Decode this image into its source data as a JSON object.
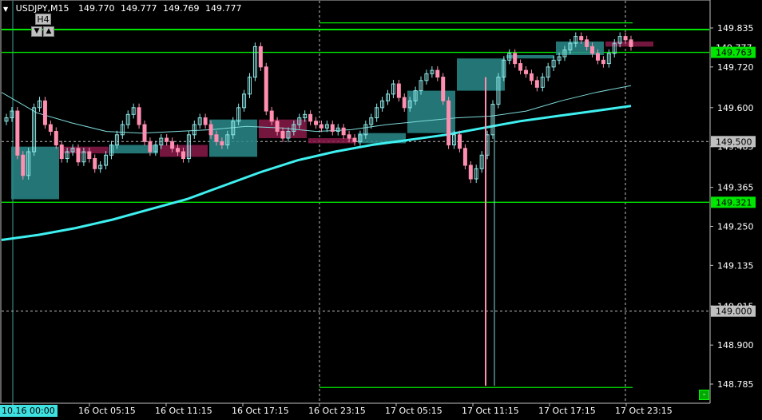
{
  "header": {
    "symbol": "USDJPY,M15",
    "open": "149.770",
    "high": "149.777",
    "low": "149.769",
    "close": "149.777"
  },
  "timeframe_box": {
    "label": "H4",
    "down": "▼",
    "up": "▲"
  },
  "minus_button": "-",
  "colors": {
    "background": "#000000",
    "bull_candle": "#8fe8e8",
    "bear_candle": "#ff8fb0",
    "bull_box": "#2a8a8a",
    "bear_box": "#8a1a4a",
    "ma_thick": "#3ff0f0",
    "ma_thin": "#7fdada",
    "hline": "#00e600",
    "price_tag_bg": "#00e600",
    "axis_text": "#ffffff"
  },
  "chart_data": {
    "type": "candlestick",
    "title": "USDJPY,M15",
    "price_axis": {
      "ticks": [
        "149.835",
        "149.720",
        "149.600",
        "149.485",
        "149.365",
        "149.250",
        "149.135",
        "149.015",
        "148.900",
        "148.785"
      ],
      "tick_values": [
        149.835,
        149.72,
        149.6,
        149.485,
        149.365,
        149.25,
        149.135,
        149.015,
        148.9,
        148.785
      ],
      "ylim": [
        148.75,
        149.87
      ],
      "current_top_label": "149.777"
    },
    "time_axis": {
      "labels": [
        "10.16 00:00",
        "16 Oct 05:15",
        "16 Oct 11:15",
        "16 Oct 17:15",
        "16 Oct 23:15",
        "17 Oct 05:15",
        "17 Oct 11:15",
        "17 Oct 17:15",
        "17 Oct 23:15"
      ]
    },
    "horizontal_levels": [
      {
        "name": "level-149.850",
        "value": 149.85,
        "color": "#00e600",
        "style": "solid"
      },
      {
        "name": "level-149.763",
        "value": 149.763,
        "color": "#00e600",
        "style": "solid",
        "label": "149.763"
      },
      {
        "name": "level-149.321",
        "value": 149.321,
        "color": "#00e600",
        "style": "solid",
        "label": "149.321"
      },
      {
        "name": "level-148.775",
        "value": 148.775,
        "color": "#00e600",
        "style": "solid"
      },
      {
        "name": "level-149.500",
        "value": 149.5,
        "color": "#c0c0c0",
        "style": "dotted",
        "label": "149.500"
      },
      {
        "name": "level-149.000",
        "value": 149.0,
        "color": "#c0c0c0",
        "style": "dotted",
        "label": "149.000"
      }
    ],
    "h4_boxes": [
      {
        "o": 149.33,
        "c": 149.485,
        "dir": "up"
      },
      {
        "o": 149.485,
        "c": 149.465,
        "dir": "down"
      },
      {
        "o": 149.465,
        "c": 149.49,
        "dir": "up"
      },
      {
        "o": 149.49,
        "c": 149.455,
        "dir": "down"
      },
      {
        "o": 149.455,
        "c": 149.565,
        "dir": "up"
      },
      {
        "o": 149.565,
        "c": 149.51,
        "dir": "down"
      },
      {
        "o": 149.51,
        "c": 149.495,
        "dir": "down"
      },
      {
        "o": 149.495,
        "c": 149.525,
        "dir": "up"
      },
      {
        "o": 149.525,
        "c": 149.65,
        "dir": "up"
      },
      {
        "o": 149.65,
        "c": 149.745,
        "dir": "up"
      },
      {
        "o": 149.745,
        "c": 149.755,
        "dir": "up"
      },
      {
        "o": 149.755,
        "c": 149.795,
        "dir": "up"
      },
      {
        "o": 149.795,
        "c": 149.78,
        "dir": "down"
      }
    ],
    "ma_long": [
      149.21,
      149.225,
      149.245,
      149.27,
      149.3,
      149.33,
      149.37,
      149.41,
      149.445,
      149.47,
      149.49,
      149.505,
      149.52,
      149.54,
      149.56,
      149.575,
      149.59,
      149.605
    ],
    "ma_mid": [
      149.645,
      149.585,
      149.555,
      149.53,
      149.525,
      149.53,
      149.535,
      149.545,
      149.54,
      149.53,
      149.535,
      149.55,
      149.56,
      149.57,
      149.575,
      149.59,
      149.62,
      149.645,
      149.665
    ],
    "candles_close": [
      149.57,
      149.59,
      149.46,
      149.4,
      149.47,
      149.6,
      149.62,
      149.55,
      149.53,
      149.49,
      149.45,
      149.47,
      149.48,
      149.44,
      149.47,
      149.45,
      149.42,
      149.43,
      149.46,
      149.49,
      149.52,
      149.55,
      149.58,
      149.6,
      149.55,
      149.5,
      149.47,
      149.49,
      149.51,
      149.5,
      149.48,
      149.47,
      149.45,
      149.52,
      149.55,
      149.57,
      149.55,
      149.52,
      149.5,
      149.49,
      149.52,
      149.56,
      149.6,
      149.64,
      149.69,
      149.78,
      149.72,
      149.59,
      149.56,
      149.53,
      149.51,
      149.53,
      149.55,
      149.57,
      149.58,
      149.56,
      149.55,
      149.54,
      149.55,
      149.53,
      149.54,
      149.52,
      149.51,
      149.5,
      149.52,
      149.55,
      149.57,
      149.6,
      149.62,
      149.64,
      149.67,
      149.63,
      149.6,
      149.62,
      149.65,
      149.68,
      149.7,
      149.71,
      149.69,
      149.62,
      149.49,
      149.52,
      149.48,
      149.43,
      149.39,
      149.42,
      149.46,
      149.52,
      149.61,
      149.69,
      149.74,
      149.76,
      149.73,
      149.71,
      149.7,
      149.68,
      149.66,
      149.69,
      149.72,
      149.74,
      149.75,
      149.77,
      149.79,
      149.81,
      149.8,
      149.78,
      149.76,
      149.74,
      149.73,
      149.76,
      149.79,
      149.81,
      149.8,
      149.78
    ]
  }
}
